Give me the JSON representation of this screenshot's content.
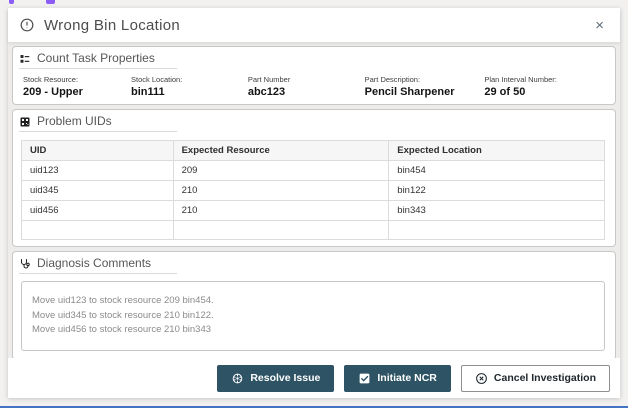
{
  "dialog": {
    "title": "Wrong Bin Location",
    "close_label": "×"
  },
  "count_task": {
    "title": "Count Task Properties",
    "fields": [
      {
        "label": "Stock Resource:",
        "value": "209 - Upper"
      },
      {
        "label": "Stock Location:",
        "value": "bin111"
      },
      {
        "label": "Part Number",
        "value": "abc123"
      },
      {
        "label": "Part Description:",
        "value": "Pencil Sharpener"
      },
      {
        "label": "Plan Interval Number:",
        "value": "29 of 50"
      }
    ]
  },
  "problem_uids": {
    "title": "Problem UIDs",
    "table": {
      "columns": [
        "UID",
        "Expected Resource",
        "Expected Location"
      ],
      "rows": [
        [
          "uid123",
          "209",
          "bin454"
        ],
        [
          "uid345",
          "210",
          "bin122"
        ],
        [
          "uid456",
          "210",
          "bin343"
        ],
        [
          "",
          "",
          ""
        ]
      ]
    }
  },
  "diagnosis": {
    "title": "Diagnosis Comments",
    "comments": [
      "Move uid123 to stock resource 209 bin454.",
      "Move uid345 to stock resource 210 bin122.",
      "Move uid456 to stock resource 210 bin343"
    ]
  },
  "footer": {
    "buttons": [
      {
        "label": "Resolve Issue",
        "style": "primary"
      },
      {
        "label": "Initiate NCR",
        "style": "primary"
      },
      {
        "label": "Cancel Investigation",
        "style": "secondary"
      }
    ]
  },
  "colors": {
    "primary_button": "#2d5365",
    "page_accent_border": "#4472c4",
    "artifact_purple": "#8b5cf6",
    "body_background": "#edecea"
  }
}
